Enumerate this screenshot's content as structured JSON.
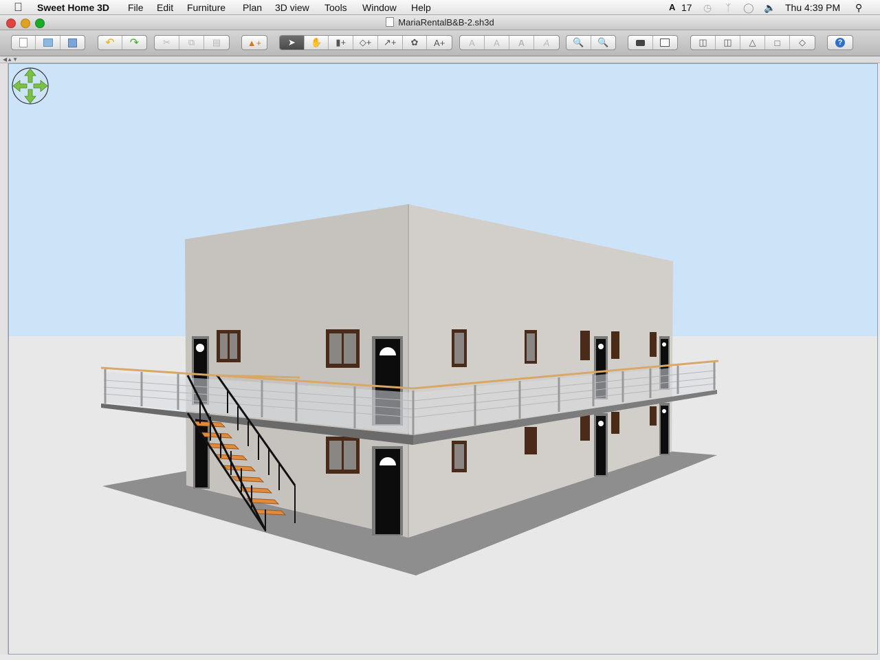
{
  "menubar": {
    "apple_icon": "apple-icon",
    "app_name": "Sweet Home 3D",
    "menus": [
      "File",
      "Edit",
      "Furniture",
      "Plan",
      "3D view",
      "Tools",
      "Window",
      "Help"
    ],
    "status": {
      "adobe_badge": "17",
      "clock": "Thu 4:39 PM",
      "icons": [
        "adobe-icon",
        "time-machine-icon",
        "bluetooth-icon",
        "wifi-icon",
        "volume-icon",
        "spotlight-icon"
      ]
    }
  },
  "window": {
    "title": "MariaRentalB&B-2.sh3d",
    "traffic_lights": {
      "close": "#e0443e",
      "minimize": "#dea123",
      "zoom": "#1aab29"
    }
  },
  "toolbar": {
    "groups": [
      [
        "new-home-icon",
        "open-icon",
        "save-icon"
      ],
      [
        "undo-icon",
        "redo-icon"
      ],
      [
        "cut-icon",
        "copy-icon",
        "paste-icon"
      ],
      [
        "add-furniture-icon"
      ],
      [
        "select-mode-icon",
        "pan-mode-icon",
        "create-walls-icon",
        "create-rooms-icon",
        "create-dimensions-icon",
        "create-polylines-icon",
        "add-text-icon"
      ],
      [
        "increase-text-size-icon",
        "decrease-text-size-icon",
        "bold-text-icon",
        "italic-text-icon"
      ],
      [
        "zoom-in-icon",
        "zoom-out-icon"
      ],
      [
        "create-photo-icon",
        "create-video-icon"
      ],
      [
        "import-furniture-icon",
        "import-library-icon",
        "flip-icon",
        "modify-room-icon",
        "modify-compass-icon"
      ],
      [
        "help-icon"
      ]
    ],
    "active_tool": "select-mode-icon"
  },
  "view3d": {
    "navigation_control": "navigation-arrows-icon",
    "colors": {
      "sky": "#cde4f8",
      "ground": "#e8e8e8",
      "wall": "#cbc8c4",
      "slab": "#8c8c8c",
      "accent": "#d8a868"
    }
  }
}
